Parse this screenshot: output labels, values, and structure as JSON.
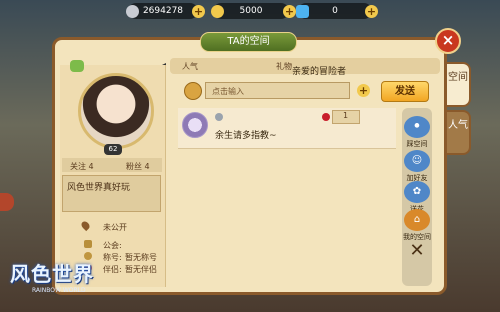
{
  "topbar": {
    "silver_coins": "2694278",
    "gold_coins": "5000",
    "diamonds": "0",
    "plus": "+"
  },
  "panel": {
    "title": "TA的空间",
    "close": "×",
    "greeting_label": "亲爱的冒险者",
    "header_left_label": "人气",
    "header_right_label": "礼物"
  },
  "profile": {
    "level": "62",
    "follow_label": "关注 4",
    "fans_label": "粉丝 4",
    "bio": "风色世界真好玩",
    "location": "未公开",
    "guild_label": "公会:",
    "guild_value": "",
    "title_label": "称号:",
    "title_value": "暂无称号",
    "partner_label": "伴侣:",
    "partner_value": "暂无伴侣"
  },
  "compose": {
    "placeholder": "点击输入",
    "send": "发送"
  },
  "message": {
    "author": "",
    "text": "余生请多指教~",
    "rose_count": "1"
  },
  "side_actions": [
    {
      "label": "踩空间"
    },
    {
      "label": "加好友"
    },
    {
      "label": "送花"
    },
    {
      "label": "我的空间"
    }
  ],
  "tabs": {
    "space": "空间",
    "popularity": "人气"
  },
  "logo": {
    "text": "风色世界",
    "sub": "RAINBOW WORLD"
  }
}
